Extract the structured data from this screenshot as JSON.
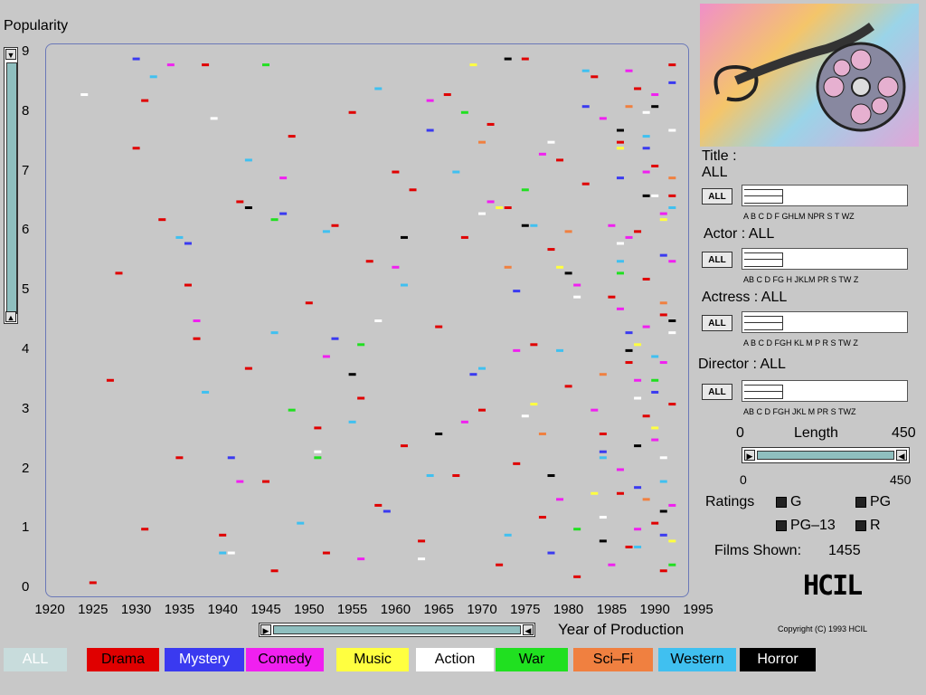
{
  "yaxis": {
    "title": "Popularity",
    "ticks": [
      "9",
      "8",
      "7",
      "6",
      "5",
      "4",
      "3",
      "2",
      "1",
      "0"
    ]
  },
  "xaxis": {
    "ticks": [
      "1920",
      "1925",
      "1930",
      "1935",
      "1940",
      "1945",
      "1950",
      "1955",
      "1960",
      "1965",
      "1970",
      "1975",
      "1980",
      "1985",
      "1990",
      "1995"
    ],
    "label": "Year of Production"
  },
  "filters": {
    "title_label": "Title :",
    "title_value": "ALL",
    "title_letters": "A B C D F GHLM NPR S  T  WZ",
    "actor_label": "Actor : ALL",
    "actor_letters": "AB  C  D FG H JKLM  PR S  TW Z",
    "actress_label": "Actress : ALL",
    "actress_letters": "A B  C  D FGH KL M  P R S  TW Z",
    "director_label": "Director : ALL",
    "director_letters": "AB  C  D FGH JKL M  PR S  TWZ",
    "all_button": "ALL"
  },
  "length": {
    "min_label": "0",
    "label": "Length",
    "max_label": "450",
    "range_min": "0",
    "range_max": "450"
  },
  "ratings": {
    "label": "Ratings",
    "options": [
      "G",
      "PG",
      "PG–13",
      "R"
    ]
  },
  "films_shown": {
    "label": "Films Shown:",
    "value": "1455"
  },
  "hcil": {
    "logo": "HCIL",
    "copyright": "Copyright (C) 1993 HCIL"
  },
  "genres": [
    {
      "label": "ALL",
      "bg": "#c8dcdc",
      "fg": "#ffffff"
    },
    {
      "label": "Drama",
      "bg": "#e00000",
      "fg": "#000000"
    },
    {
      "label": "Mystery",
      "bg": "#3a3af0",
      "fg": "#ffffff"
    },
    {
      "label": "Comedy",
      "bg": "#f020f0",
      "fg": "#000000"
    },
    {
      "label": "Music",
      "bg": "#ffff40",
      "fg": "#000000"
    },
    {
      "label": "Action",
      "bg": "#ffffff",
      "fg": "#000000"
    },
    {
      "label": "War",
      "bg": "#20e020",
      "fg": "#000000"
    },
    {
      "label": "Sci–Fi",
      "bg": "#f08040",
      "fg": "#000000"
    },
    {
      "label": "Western",
      "bg": "#40c0f0",
      "fg": "#000000"
    },
    {
      "label": "Horror",
      "bg": "#000000",
      "fg": "#ffffff"
    }
  ],
  "chart_data": {
    "type": "scatter",
    "xlabel": "Year of Production",
    "ylabel": "Popularity",
    "xlim": [
      1920,
      1995
    ],
    "ylim": [
      0,
      9
    ],
    "series": [
      {
        "name": "Drama",
        "color": "#e00000",
        "points": [
          [
            1925,
            0.1
          ],
          [
            1927,
            3.5
          ],
          [
            1928,
            5.3
          ],
          [
            1930,
            7.4
          ],
          [
            1931,
            1.0
          ],
          [
            1931,
            8.2
          ],
          [
            1933,
            6.2
          ],
          [
            1935,
            2.2
          ],
          [
            1936,
            5.1
          ],
          [
            1937,
            4.2
          ],
          [
            1938,
            8.8
          ],
          [
            1940,
            0.9
          ],
          [
            1942,
            6.5
          ],
          [
            1943,
            3.7
          ],
          [
            1945,
            1.8
          ],
          [
            1946,
            0.3
          ],
          [
            1948,
            7.6
          ],
          [
            1950,
            4.8
          ],
          [
            1951,
            2.7
          ],
          [
            1952,
            0.6
          ],
          [
            1953,
            6.1
          ],
          [
            1955,
            8.0
          ],
          [
            1956,
            3.2
          ],
          [
            1957,
            5.5
          ],
          [
            1958,
            1.4
          ],
          [
            1960,
            7.0
          ],
          [
            1961,
            2.4
          ],
          [
            1962,
            6.7
          ],
          [
            1963,
            0.8
          ],
          [
            1965,
            4.4
          ],
          [
            1966,
            8.3
          ],
          [
            1967,
            1.9
          ],
          [
            1968,
            5.9
          ],
          [
            1970,
            3.0
          ],
          [
            1971,
            7.8
          ],
          [
            1972,
            0.4
          ],
          [
            1973,
            6.4
          ],
          [
            1974,
            2.1
          ],
          [
            1975,
            8.9
          ],
          [
            1976,
            4.1
          ],
          [
            1977,
            1.2
          ],
          [
            1978,
            5.7
          ],
          [
            1979,
            7.2
          ],
          [
            1980,
            3.4
          ],
          [
            1981,
            0.2
          ],
          [
            1982,
            6.8
          ],
          [
            1983,
            8.6
          ],
          [
            1984,
            2.6
          ],
          [
            1985,
            4.9
          ],
          [
            1986,
            1.6
          ],
          [
            1986,
            7.5
          ],
          [
            1987,
            3.8
          ],
          [
            1987,
            0.7
          ],
          [
            1988,
            6.0
          ],
          [
            1988,
            8.4
          ],
          [
            1989,
            2.9
          ],
          [
            1989,
            5.2
          ],
          [
            1990,
            1.1
          ],
          [
            1990,
            7.1
          ],
          [
            1991,
            4.6
          ],
          [
            1991,
            0.3
          ],
          [
            1992,
            6.6
          ],
          [
            1992,
            3.1
          ],
          [
            1992,
            8.8
          ]
        ]
      },
      {
        "name": "Mystery",
        "color": "#3a3af0",
        "points": [
          [
            1930,
            8.9
          ],
          [
            1936,
            5.8
          ],
          [
            1941,
            2.2
          ],
          [
            1947,
            6.3
          ],
          [
            1953,
            4.2
          ],
          [
            1959,
            1.3
          ],
          [
            1964,
            7.7
          ],
          [
            1969,
            3.6
          ],
          [
            1974,
            5.0
          ],
          [
            1978,
            0.6
          ],
          [
            1982,
            8.1
          ],
          [
            1984,
            2.3
          ],
          [
            1986,
            6.9
          ],
          [
            1987,
            4.3
          ],
          [
            1988,
            1.7
          ],
          [
            1989,
            7.4
          ],
          [
            1990,
            3.3
          ],
          [
            1991,
            5.6
          ],
          [
            1991,
            0.9
          ],
          [
            1992,
            8.5
          ]
        ]
      },
      {
        "name": "Comedy",
        "color": "#f020f0",
        "points": [
          [
            1934,
            8.8
          ],
          [
            1937,
            4.5
          ],
          [
            1942,
            1.8
          ],
          [
            1947,
            6.9
          ],
          [
            1952,
            3.9
          ],
          [
            1956,
            0.5
          ],
          [
            1960,
            5.4
          ],
          [
            1964,
            8.2
          ],
          [
            1968,
            2.8
          ],
          [
            1971,
            6.5
          ],
          [
            1974,
            4.0
          ],
          [
            1977,
            7.3
          ],
          [
            1979,
            1.5
          ],
          [
            1981,
            5.1
          ],
          [
            1983,
            3.0
          ],
          [
            1984,
            7.9
          ],
          [
            1985,
            0.4
          ],
          [
            1985,
            6.1
          ],
          [
            1986,
            4.7
          ],
          [
            1986,
            2.0
          ],
          [
            1987,
            8.7
          ],
          [
            1987,
            5.9
          ],
          [
            1988,
            3.5
          ],
          [
            1988,
            1.0
          ],
          [
            1989,
            7.0
          ],
          [
            1989,
            4.4
          ],
          [
            1990,
            2.5
          ],
          [
            1990,
            8.3
          ],
          [
            1991,
            6.3
          ],
          [
            1991,
            3.8
          ],
          [
            1992,
            1.4
          ],
          [
            1992,
            5.5
          ]
        ]
      },
      {
        "name": "Music",
        "color": "#ffff40",
        "points": [
          [
            1969,
            8.8
          ],
          [
            1972,
            6.4
          ],
          [
            1976,
            3.1
          ],
          [
            1979,
            5.4
          ],
          [
            1983,
            1.6
          ],
          [
            1986,
            7.4
          ],
          [
            1988,
            4.1
          ],
          [
            1990,
            2.7
          ],
          [
            1991,
            6.2
          ],
          [
            1992,
            0.8
          ]
        ]
      },
      {
        "name": "Action",
        "color": "#ffffff",
        "points": [
          [
            1924,
            8.3
          ],
          [
            1939,
            7.9
          ],
          [
            1941,
            0.6
          ],
          [
            1951,
            2.3
          ],
          [
            1958,
            4.5
          ],
          [
            1963,
            0.5
          ],
          [
            1970,
            6.3
          ],
          [
            1975,
            2.9
          ],
          [
            1978,
            7.5
          ],
          [
            1981,
            4.9
          ],
          [
            1984,
            1.2
          ],
          [
            1986,
            5.8
          ],
          [
            1988,
            3.2
          ],
          [
            1989,
            8.0
          ],
          [
            1990,
            6.6
          ],
          [
            1991,
            2.2
          ],
          [
            1992,
            4.3
          ],
          [
            1992,
            7.7
          ]
        ]
      },
      {
        "name": "War",
        "color": "#20e020",
        "points": [
          [
            1945,
            8.8
          ],
          [
            1946,
            6.2
          ],
          [
            1948,
            3.0
          ],
          [
            1951,
            2.2
          ],
          [
            1956,
            4.1
          ],
          [
            1968,
            8.0
          ],
          [
            1975,
            6.7
          ],
          [
            1981,
            1.0
          ],
          [
            1986,
            5.3
          ],
          [
            1990,
            3.5
          ],
          [
            1992,
            0.4
          ]
        ]
      },
      {
        "name": "Sci–Fi",
        "color": "#f08040",
        "points": [
          [
            1970,
            7.5
          ],
          [
            1973,
            5.4
          ],
          [
            1977,
            2.6
          ],
          [
            1980,
            6.0
          ],
          [
            1984,
            3.6
          ],
          [
            1987,
            8.1
          ],
          [
            1989,
            1.5
          ],
          [
            1991,
            4.8
          ],
          [
            1992,
            6.9
          ]
        ]
      },
      {
        "name": "Western",
        "color": "#40c0f0",
        "points": [
          [
            1932,
            8.6
          ],
          [
            1935,
            5.9
          ],
          [
            1938,
            3.3
          ],
          [
            1940,
            0.6
          ],
          [
            1943,
            7.2
          ],
          [
            1946,
            4.3
          ],
          [
            1949,
            1.1
          ],
          [
            1952,
            6.0
          ],
          [
            1955,
            2.8
          ],
          [
            1958,
            8.4
          ],
          [
            1961,
            5.1
          ],
          [
            1964,
            1.9
          ],
          [
            1967,
            7.0
          ],
          [
            1970,
            3.7
          ],
          [
            1973,
            0.9
          ],
          [
            1976,
            6.1
          ],
          [
            1979,
            4.0
          ],
          [
            1982,
            8.7
          ],
          [
            1984,
            2.2
          ],
          [
            1986,
            5.5
          ],
          [
            1988,
            0.7
          ],
          [
            1989,
            7.6
          ],
          [
            1990,
            3.9
          ],
          [
            1991,
            1.8
          ],
          [
            1992,
            6.4
          ]
        ]
      },
      {
        "name": "Horror",
        "color": "#000000",
        "points": [
          [
            1943,
            6.4
          ],
          [
            1955,
            3.6
          ],
          [
            1961,
            5.9
          ],
          [
            1965,
            2.6
          ],
          [
            1973,
            8.9
          ],
          [
            1975,
            6.1
          ],
          [
            1978,
            1.9
          ],
          [
            1980,
            5.3
          ],
          [
            1984,
            0.8
          ],
          [
            1986,
            7.7
          ],
          [
            1987,
            4.0
          ],
          [
            1988,
            2.4
          ],
          [
            1989,
            6.6
          ],
          [
            1990,
            8.1
          ],
          [
            1991,
            1.3
          ],
          [
            1992,
            4.5
          ]
        ]
      }
    ]
  }
}
